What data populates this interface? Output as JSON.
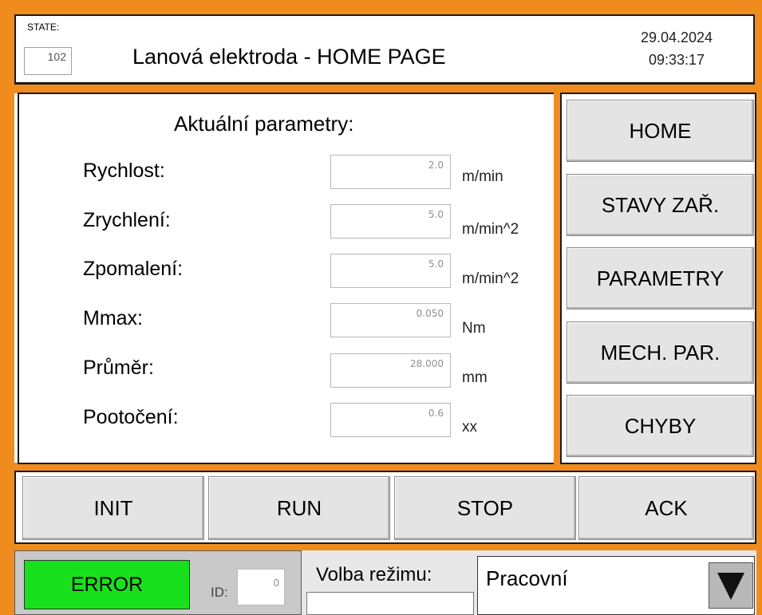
{
  "header": {
    "state_label": "STATE:",
    "state_value": "102",
    "title": "Lanová elektroda - HOME PAGE",
    "date": "29.04.2024",
    "time": "09:33:17"
  },
  "params": {
    "title": "Aktuální parametry:",
    "rows": [
      {
        "label": "Rychlost:",
        "value": "2.0",
        "unit": "m/min"
      },
      {
        "label": "Zrychlení:",
        "value": "5.0",
        "unit": "m/min^2"
      },
      {
        "label": "Zpomalení:",
        "value": "5.0",
        "unit": "m/min^2"
      },
      {
        "label": "Mmax:",
        "value": "0.050",
        "unit": "Nm"
      },
      {
        "label": "Průměr:",
        "value": "28.000",
        "unit": "mm"
      },
      {
        "label": "Pootočení:",
        "value": "0.6",
        "unit": "xx"
      }
    ]
  },
  "nav": {
    "home": "HOME",
    "stavy": "STAVY ZAŘ.",
    "parametry": "PARAMETRY",
    "mech": "MECH. PAR.",
    "chyby": "CHYBY"
  },
  "controls": {
    "init": "INIT",
    "run": "RUN",
    "stop": "STOP",
    "ack": "ACK"
  },
  "status": {
    "error": "ERROR",
    "id_label": "ID:",
    "id_value": "0",
    "mode_label": "Volba režimu:",
    "mode_value": "Pracovní"
  },
  "colors": {
    "frame": "#f08c1e",
    "error_bg": "#19e01c",
    "button_bg": "#e4e4e4"
  }
}
